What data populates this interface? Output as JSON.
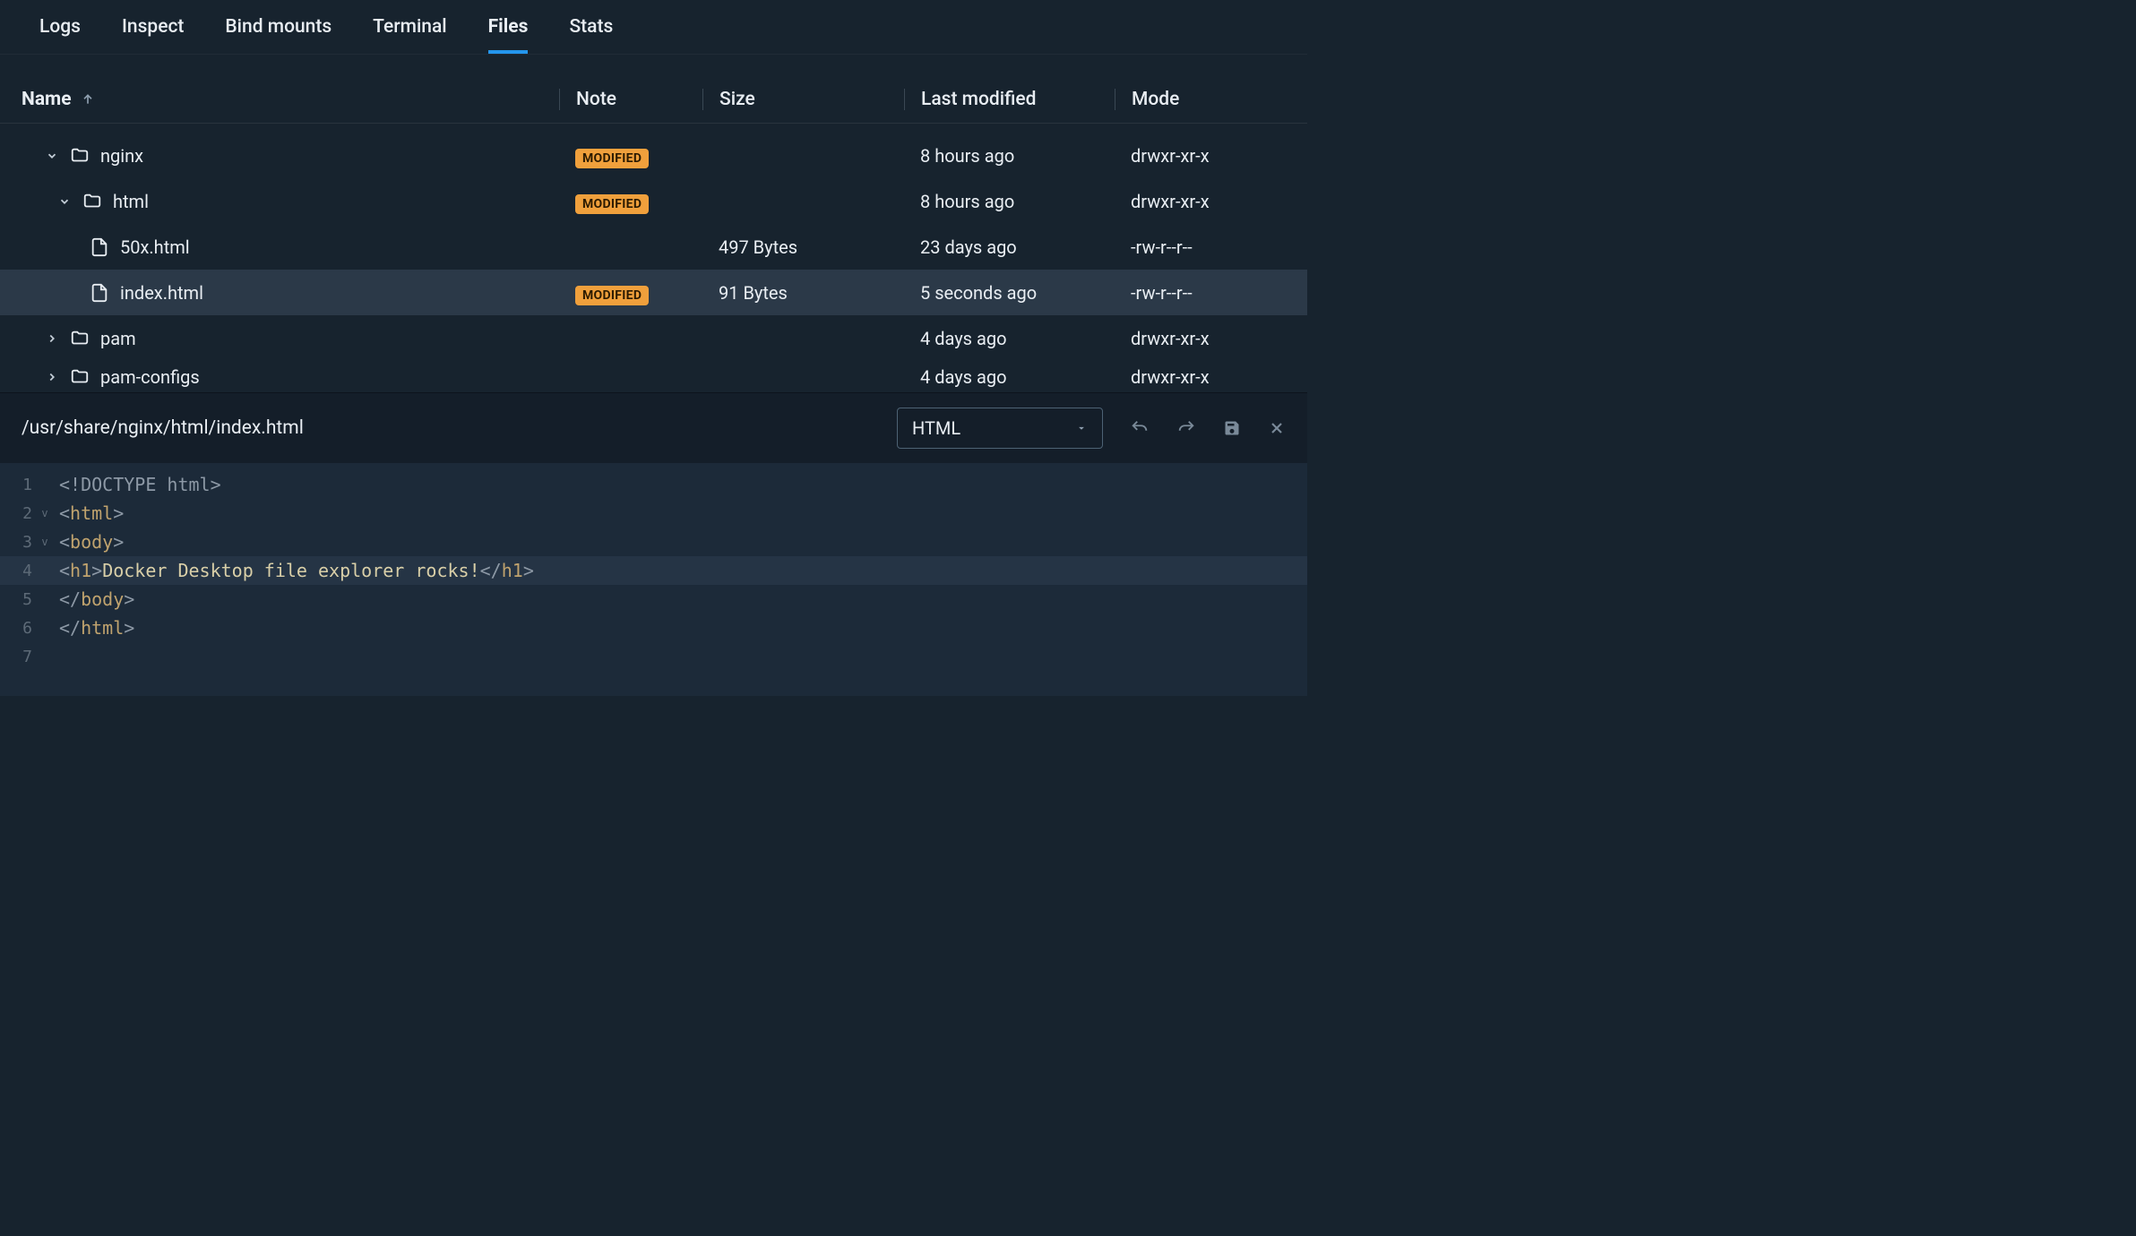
{
  "tabs": {
    "logs": "Logs",
    "inspect": "Inspect",
    "bind_mounts": "Bind mounts",
    "terminal": "Terminal",
    "files": "Files",
    "stats": "Stats",
    "active": "files"
  },
  "columns": {
    "name": "Name",
    "note": "Note",
    "size": "Size",
    "modified": "Last modified",
    "mode": "Mode"
  },
  "badge_text": "MODIFIED",
  "files": {
    "nginx": {
      "name": "nginx",
      "modified": "8 hours ago",
      "mode": "drwxr-xr-x"
    },
    "html_dir": {
      "name": "html",
      "modified": "8 hours ago",
      "mode": "drwxr-xr-x"
    },
    "file_50x": {
      "name": "50x.html",
      "size": "497 Bytes",
      "modified": "23 days ago",
      "mode": "-rw-r--r--"
    },
    "file_index": {
      "name": "index.html",
      "size": "91 Bytes",
      "modified": "5 seconds ago",
      "mode": "-rw-r--r--"
    },
    "pam": {
      "name": "pam",
      "modified": "4 days ago",
      "mode": "drwxr-xr-x"
    },
    "pam_configs": {
      "name": "pam-configs",
      "modified": "4 days ago",
      "mode": "drwxr-xr-x"
    }
  },
  "editor": {
    "path": "/usr/share/nginx/html/index.html",
    "language": "HTML",
    "lines": {
      "l1_a": "<!DOCTYPE html>",
      "l2_a": "<",
      "l2_b": "html",
      "l2_c": ">",
      "l3_a": "<",
      "l3_b": "body",
      "l3_c": ">",
      "l4_a": "<",
      "l4_b": "h1",
      "l4_c": ">",
      "l4_d": "Docker Desktop file explorer rocks!",
      "l4_e": "</",
      "l4_f": "h1",
      "l4_g": ">",
      "l5_a": "</",
      "l5_b": "body",
      "l5_c": ">",
      "l6_a": "</",
      "l6_b": "html",
      "l6_c": ">"
    },
    "line_numbers": {
      "n1": "1",
      "n2": "2",
      "n3": "3",
      "n4": "4",
      "n5": "5",
      "n6": "6",
      "n7": "7"
    }
  }
}
